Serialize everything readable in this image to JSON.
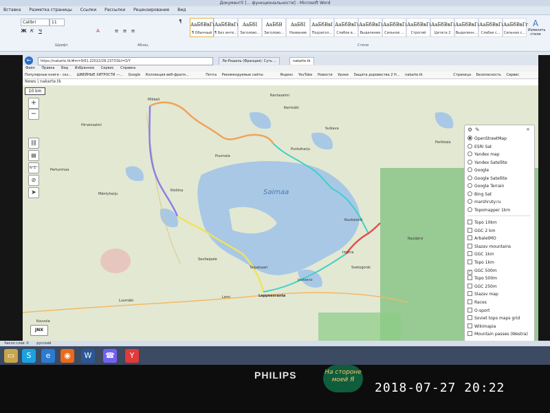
{
  "word": {
    "title": "Документ5 [... функциональности] - Microsoft Word",
    "tabs": [
      "Вставка",
      "Разметка страницы",
      "Ссылки",
      "Рассылки",
      "Рецензирование",
      "Вид"
    ],
    "font_name": "Calibri",
    "font_size": "11",
    "group_labels": {
      "font": "Шрифт",
      "paragraph": "Абзац",
      "styles": "Стили"
    },
    "styles": [
      {
        "sample": "АаБбВвГг",
        "name": "¶ Обычный"
      },
      {
        "sample": "АаБбВвГг",
        "name": "¶ Без инте..."
      },
      {
        "sample": "АаБбI",
        "name": "Заголово..."
      },
      {
        "sample": "АаБбВ",
        "name": "Заголово..."
      },
      {
        "sample": "АаБбI",
        "name": "Название"
      },
      {
        "sample": "АаБбВвI",
        "name": "Подзагол..."
      },
      {
        "sample": "АаБбВвГг",
        "name": "Слабое в..."
      },
      {
        "sample": "АаБбВвГг",
        "name": "Выделение"
      },
      {
        "sample": "АаБбВвГг",
        "name": "Сильное ..."
      },
      {
        "sample": "АаБбВвГг",
        "name": "Строгий"
      },
      {
        "sample": "АаБбВвГг",
        "name": "Цитата 2"
      },
      {
        "sample": "АаБбВвГг",
        "name": "Выделенн..."
      },
      {
        "sample": "АаБбВвГг",
        "name": "Слабая с..."
      },
      {
        "sample": "АаБбВвГг",
        "name": "Сильная с..."
      }
    ],
    "change_styles": "Изменить стили",
    "status_words": "Число слов: 0",
    "status_lang": "русский"
  },
  "browser": {
    "address": "https://nakarte.tk/#m=9/61.22022/28.23733&l=O/Y",
    "tabs": [
      "Ле-Рошель (Франция): Суть ...",
      "nakarte.tk"
    ],
    "menu": [
      "Файл",
      "Правка",
      "Вид",
      "Избранное",
      "Сервис",
      "Справка"
    ],
    "favorites": [
      "Популярные книги - скз...",
      "ШВЕЙНЫЕ ХИТРОСТИ —...",
      "Google",
      "Коллекция веб-фрагм...",
      "Почта",
      "Рекомендуемые сайты",
      "Яндекс",
      "YouTube",
      "Новости",
      "Уроки",
      "Защита доровества 2 Н...",
      "nakarte.tk"
    ],
    "toolbar_right": [
      "Страница",
      "Безопасность",
      "Сервис"
    ],
    "page_header": "News | nakarte.tk"
  },
  "map": {
    "scale": "10 km",
    "zoom_in": "+",
    "zoom_out": "−",
    "jnx_button": "JNX",
    "labels": {
      "lake": "Saimaa",
      "places": [
        "Mikkeli",
        "Puumala",
        "Ruokolahti",
        "Imatra",
        "Svetogorsk",
        "Lappeenranta",
        "Taipalsaari",
        "Savitaipale",
        "Mäntyharju",
        "Pertunmaa",
        "Hirvensalmi",
        "Kerimäki",
        "Punkaharju",
        "Parikkala",
        "Rautjärvi",
        "Joutseno",
        "Lemi",
        "Luumäki",
        "Kouvola",
        "Sulkava",
        "Rantasalmi",
        "Ristiina"
      ]
    },
    "route_colors": {
      "orange": "#f0a35a",
      "cyan": "#3fd0c8",
      "purple": "#8b7ee6",
      "yellow": "#f0e35a",
      "red": "#e05050"
    }
  },
  "layers": {
    "base": [
      {
        "name": "OpenStreetMap",
        "selected": true
      },
      {
        "name": "ESRI Sat",
        "selected": false
      },
      {
        "name": "Yandex map",
        "selected": false
      },
      {
        "name": "Yandex Satellite",
        "selected": false
      },
      {
        "name": "Google",
        "selected": false
      },
      {
        "name": "Google Satellite",
        "selected": false
      },
      {
        "name": "Google Terrain",
        "selected": false
      },
      {
        "name": "Bing Sat",
        "selected": false
      },
      {
        "name": "marshruty.ru",
        "selected": false
      },
      {
        "name": "Topomapper 1km",
        "selected": false
      }
    ],
    "overlays": [
      {
        "name": "Topo 10km",
        "checked": false
      },
      {
        "name": "GGC 2 km",
        "checked": false
      },
      {
        "name": "ArbaletMO",
        "checked": false
      },
      {
        "name": "Slazav mountains",
        "checked": false
      },
      {
        "name": "GGC 1km",
        "checked": false
      },
      {
        "name": "Topo 1km",
        "checked": false
      },
      {
        "name": "GGC 500m",
        "checked": true
      },
      {
        "name": "Topo 500m",
        "checked": false
      },
      {
        "name": "GGC 250m",
        "checked": false
      },
      {
        "name": "Slazav map",
        "checked": false
      },
      {
        "name": "Races",
        "checked": false
      },
      {
        "name": "O-sport",
        "checked": false
      },
      {
        "name": "Soviet topo maps grid",
        "checked": false
      },
      {
        "name": "Wikimapia",
        "checked": false
      },
      {
        "name": "Mountain passes (Westra)",
        "checked": false
      }
    ]
  },
  "monitor": {
    "brand": "PHILIPS",
    "sticker": "На стороне моей Я",
    "timestamp": "2018-07-27 20:22"
  }
}
